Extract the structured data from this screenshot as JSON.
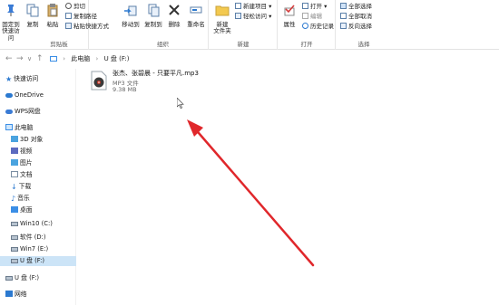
{
  "ribbon": {
    "clipboard": {
      "label": "剪贴板",
      "pin_label_1": "固定到",
      "pin_label_2": "快速访问",
      "copy_label": "复制",
      "paste_label": "粘贴",
      "cut_label": "剪切",
      "copy_path_label": "复制路径",
      "paste_shortcut_label": "粘贴快捷方式"
    },
    "organize": {
      "label": "组织",
      "move_to_label": "移动到",
      "copy_to_label": "复制到",
      "delete_label": "删除",
      "rename_label": "重命名"
    },
    "new": {
      "label": "新建",
      "new_folder_1": "新建",
      "new_folder_2": "文件夹",
      "new_item_label": "新建项目",
      "easy_access_label": "轻松访问"
    },
    "open": {
      "label": "打开",
      "properties_label": "属性",
      "open_label": "打开",
      "edit_label": "编辑",
      "history_label": "历史记录"
    },
    "select": {
      "label": "选择",
      "select_all_label": "全部选择",
      "select_none_label": "全部取消",
      "invert_label": "反向选择"
    }
  },
  "address": {
    "crumbs": [
      "此电脑",
      "U 盘 (F:)"
    ]
  },
  "sidebar": {
    "items": [
      {
        "label": "快速访问",
        "icon": "star-icon",
        "color": "#2b79d0"
      },
      {
        "label": "OneDrive",
        "icon": "cloud-icon",
        "color": "#2b79d0"
      },
      {
        "label": "WPS网盘",
        "icon": "cloud-icon",
        "color": "#3a7bd5"
      },
      {
        "label": "此电脑",
        "icon": "computer-icon",
        "color": "#3a8ee6"
      },
      {
        "label": "3D 对象",
        "icon": "cube-icon",
        "color": "#4aa3df"
      },
      {
        "label": "视频",
        "icon": "video-icon",
        "color": "#5c6bc0"
      },
      {
        "label": "图片",
        "icon": "picture-icon",
        "color": "#4aa3df"
      },
      {
        "label": "文档",
        "icon": "document-icon",
        "color": "#7b8ea3"
      },
      {
        "label": "下载",
        "icon": "download-icon",
        "color": "#2b79d0"
      },
      {
        "label": "音乐",
        "icon": "music-icon",
        "color": "#2b79d0"
      },
      {
        "label": "桌面",
        "icon": "desktop-icon",
        "color": "#3a8ee6"
      },
      {
        "label": "Win10 (C:)",
        "icon": "drive-icon",
        "color": "#6b7b8c"
      },
      {
        "label": "软件 (D:)",
        "icon": "drive-icon",
        "color": "#6b7b8c"
      },
      {
        "label": "Win7 (E:)",
        "icon": "drive-icon",
        "color": "#6b7b8c"
      },
      {
        "label": "U 盘 (F:)",
        "icon": "usb-drive-icon",
        "color": "#6b7b8c"
      },
      {
        "label": "U 盘 (F:)",
        "icon": "usb-drive-icon",
        "color": "#6b7b8c"
      },
      {
        "label": "网络",
        "icon": "network-icon",
        "color": "#2b79d0"
      }
    ]
  },
  "file": {
    "name": "张杰、张碧晨 - 只要平凡.mp3",
    "type": "MP3 文件",
    "size": "9.38 MB"
  },
  "colors": {
    "selection": "#cce4f7",
    "annotation_arrow": "#e0272b"
  }
}
